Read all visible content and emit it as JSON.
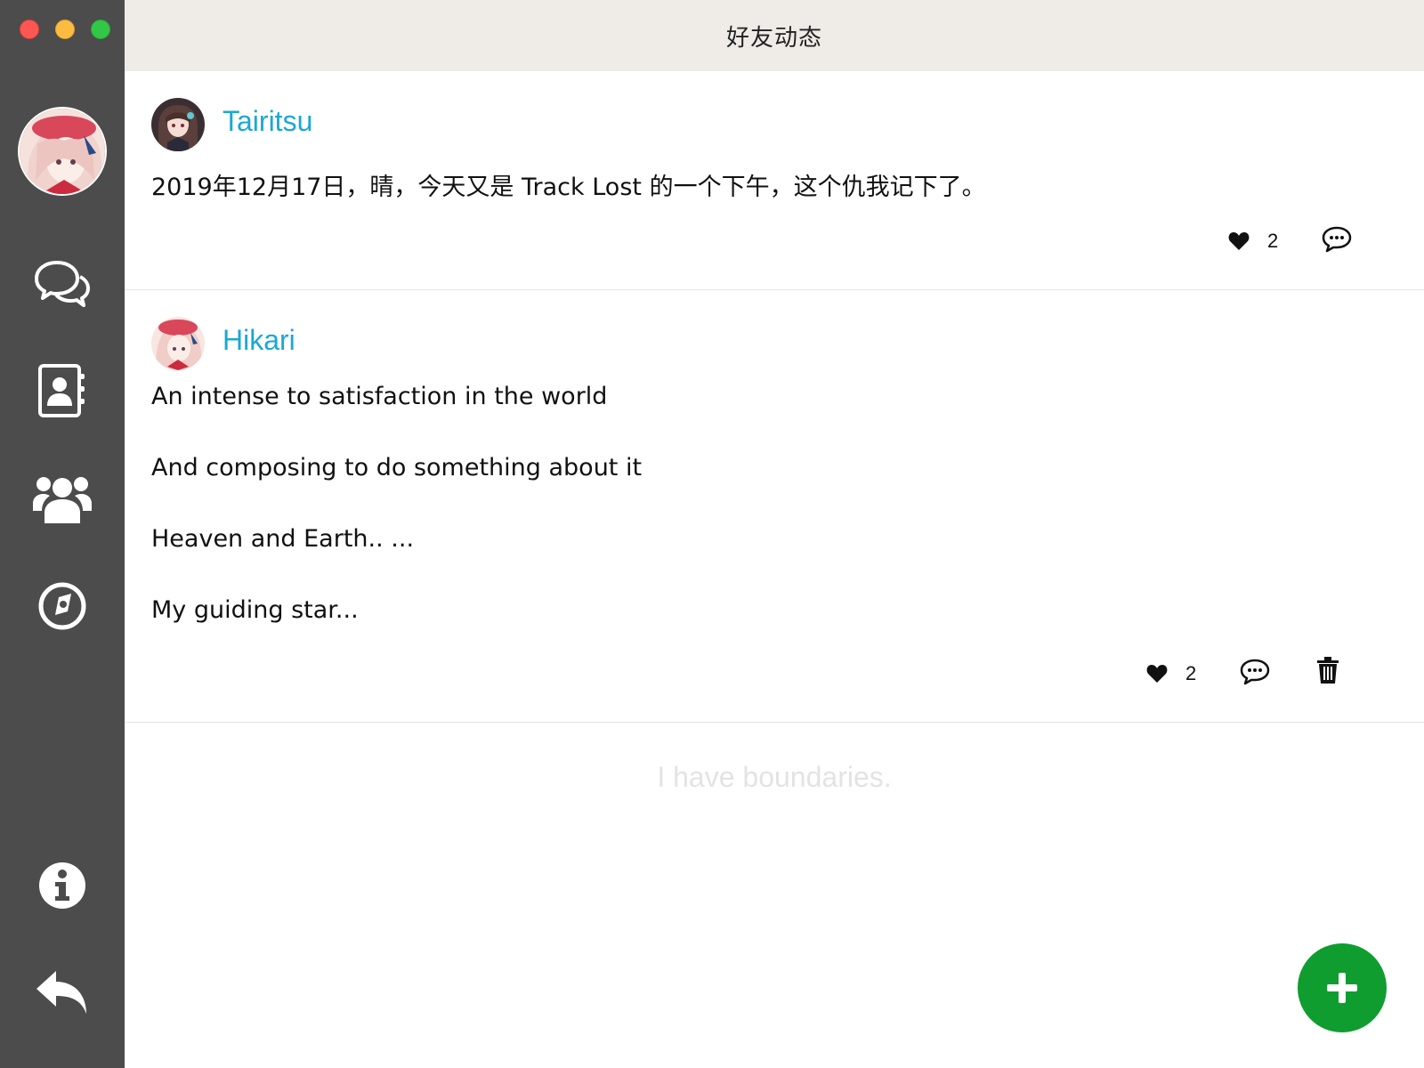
{
  "window": {
    "title": "好友动态"
  },
  "sidebar": {
    "items": [
      {
        "name": "messages",
        "icon": "chat-bubbles-icon"
      },
      {
        "name": "contacts",
        "icon": "address-book-icon"
      },
      {
        "name": "groups",
        "icon": "group-icon"
      },
      {
        "name": "discover",
        "icon": "compass-icon"
      },
      {
        "name": "about",
        "icon": "info-icon"
      },
      {
        "name": "logout",
        "icon": "reply-back-icon"
      }
    ]
  },
  "posts": [
    {
      "author": "Tairitsu",
      "text": "2019年12月17日，晴，今天又是 Track Lost 的一个下午，这个仇我记下了。",
      "likes": "2"
    },
    {
      "author": "Hikari",
      "lines": [
        "An intense to satisfaction in the world",
        "And composing to do something about it",
        "Heaven and Earth.. ...",
        "My guiding star..."
      ],
      "likes": "2"
    }
  ],
  "feed": {
    "end_message": "I have boundaries."
  },
  "colors": {
    "sidebar": "#4c4c4c",
    "titlebar": "#efebe7",
    "author_link": "#1ba8d3",
    "fab": "#0f9d2f"
  }
}
